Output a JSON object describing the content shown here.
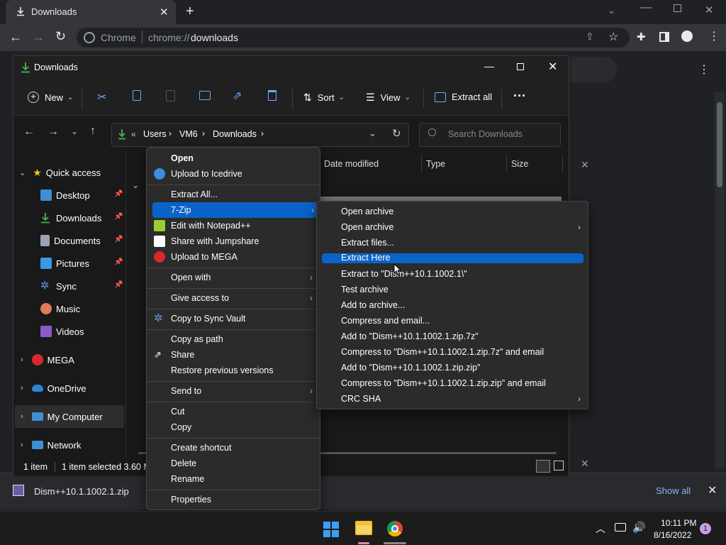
{
  "chrome": {
    "tab_title": "Downloads",
    "omnibox_site": "Chrome",
    "omnibox_url_prefix": "chrome://",
    "omnibox_url_path": "downloads"
  },
  "explorer": {
    "title": "Downloads",
    "cmd": {
      "new": "New",
      "sort": "Sort",
      "view": "View",
      "extract_all": "Extract all"
    },
    "breadcrumb": [
      "Users",
      "VM6",
      "Downloads"
    ],
    "search_placeholder": "Search Downloads",
    "columns": [
      "Date modified",
      "Type",
      "Size"
    ],
    "nav": {
      "quick_access": "Quick access",
      "items": [
        "Desktop",
        "Downloads",
        "Documents",
        "Pictures",
        "Sync",
        "Music",
        "Videos"
      ],
      "mega": "MEGA",
      "onedrive": "OneDrive",
      "my_computer": "My Computer",
      "network": "Network"
    },
    "status": {
      "count": "1 item",
      "selected": "1 item selected 3.60 M"
    }
  },
  "context_menu": {
    "items": {
      "open": "Open",
      "icedrive": "Upload to Icedrive",
      "extract_all": "Extract All...",
      "sevenzip": "7-Zip",
      "notepad": "Edit with Notepad++",
      "jumpshare": "Share with Jumpshare",
      "mega": "Upload to MEGA",
      "open_with": "Open with",
      "give_access": "Give access to",
      "sync_vault": "Copy to Sync Vault",
      "copy_path": "Copy as path",
      "share": "Share",
      "restore": "Restore previous versions",
      "send_to": "Send to",
      "cut": "Cut",
      "copy": "Copy",
      "shortcut": "Create shortcut",
      "delete": "Delete",
      "rename": "Rename",
      "properties": "Properties"
    }
  },
  "sevenzip_menu": {
    "items": [
      "Open archive",
      "Open archive",
      "Extract files...",
      "Extract Here",
      "Extract to \"Dism++10.1.1002.1\\\"",
      "Test archive",
      "Add to archive...",
      "Compress and email...",
      "Add to \"Dism++10.1.1002.1.zip.7z\"",
      "Compress to \"Dism++10.1.1002.1.zip.7z\" and email",
      "Add to \"Dism++10.1.1002.1.zip.zip\"",
      "Compress to \"Dism++10.1.1002.1.zip.zip\" and email",
      "CRC SHA"
    ]
  },
  "download_shelf": {
    "filename": "Dism++10.1.1002.1.zip",
    "show_all": "Show all"
  },
  "taskbar": {
    "time": "10:11 PM",
    "date": "8/16/2022",
    "notifications": "1"
  },
  "colors": {
    "highlight": "#0a63c9",
    "accent_blue": "#8ab4f8"
  }
}
